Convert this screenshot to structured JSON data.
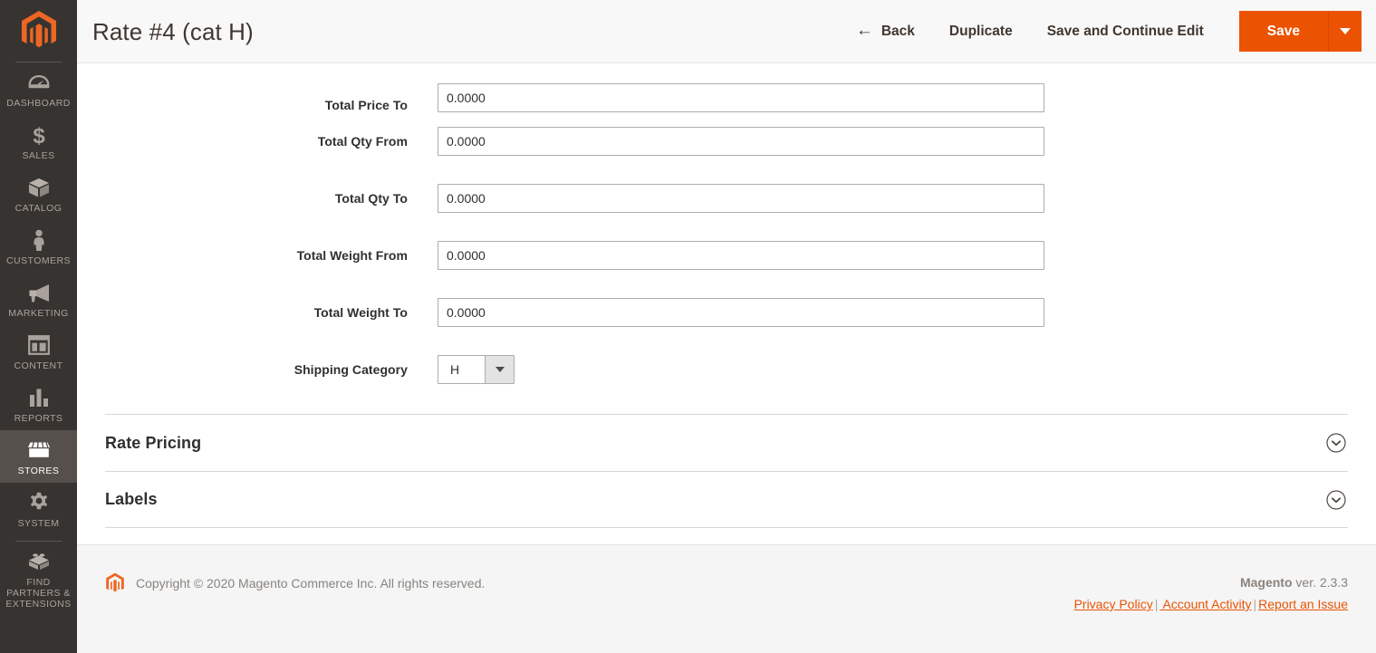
{
  "sidebar": {
    "logo": "magento-logo",
    "items": [
      {
        "label": "Dashboard",
        "icon": "dashboard-gauge-icon",
        "active": false
      },
      {
        "label": "Sales",
        "icon": "dollar-sign-icon",
        "active": false
      },
      {
        "label": "Catalog",
        "icon": "box-icon",
        "active": false
      },
      {
        "label": "Customers",
        "icon": "person-icon",
        "active": false
      },
      {
        "label": "Marketing",
        "icon": "megaphone-icon",
        "active": false
      },
      {
        "label": "Content",
        "icon": "layout-panel-icon",
        "active": false
      },
      {
        "label": "Reports",
        "icon": "bar-chart-icon",
        "active": false
      },
      {
        "label": "Stores",
        "icon": "storefront-icon",
        "active": true
      },
      {
        "label": "System",
        "icon": "gear-icon",
        "active": false
      },
      {
        "label": "Find Partners\n& Extensions",
        "icon": "lego-block-icon",
        "active": false
      }
    ]
  },
  "header": {
    "title": "Rate #4 (cat H)",
    "back_label": "Back",
    "back_icon": "arrow-left-icon",
    "duplicate_label": "Duplicate",
    "save_continue_label": "Save and Continue Edit",
    "save_label": "Save",
    "save_menu_icon": "caret-down-icon",
    "primary_color": "#eb5202"
  },
  "form": {
    "fields": [
      {
        "label": "Total Price To",
        "value": "0.0000",
        "type": "text"
      },
      {
        "label": "Total Qty From",
        "value": "0.0000",
        "type": "text"
      },
      {
        "label": "Total Qty To",
        "value": "0.0000",
        "type": "text"
      },
      {
        "label": "Total Weight From",
        "value": "0.0000",
        "type": "text"
      },
      {
        "label": "Total Weight To",
        "value": "0.0000",
        "type": "text"
      }
    ],
    "shipping_category": {
      "label": "Shipping Category",
      "value": "H",
      "icon": "caret-down-icon"
    }
  },
  "sections": [
    {
      "title": "Rate Pricing",
      "icon": "chevron-down-circle-icon",
      "expanded": false
    },
    {
      "title": "Labels",
      "icon": "chevron-down-circle-icon",
      "expanded": false
    }
  ],
  "footer": {
    "logo": "magento-logo-small",
    "copyright": "Copyright © 2020 Magento Commerce Inc. All rights reserved.",
    "brand": "Magento",
    "version": " ver. 2.3.3",
    "links": [
      {
        "label": "Privacy Policy"
      },
      {
        "label": " Account Activity"
      },
      {
        "label": "Report an Issue"
      }
    ],
    "separator": "|"
  }
}
